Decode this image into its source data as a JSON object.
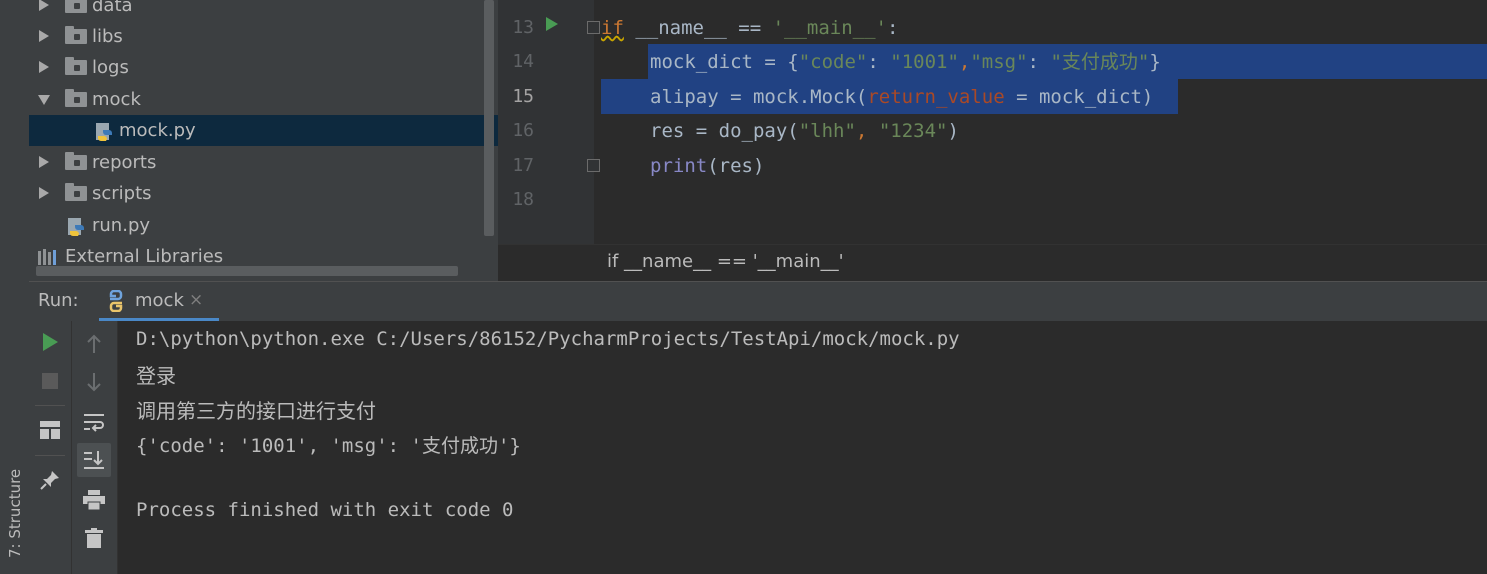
{
  "project_tree": {
    "items": [
      {
        "label": "data",
        "type": "folder",
        "expanded": false
      },
      {
        "label": "libs",
        "type": "folder",
        "expanded": false
      },
      {
        "label": "logs",
        "type": "folder",
        "expanded": false
      },
      {
        "label": "mock",
        "type": "folder",
        "expanded": true
      },
      {
        "label": "mock.py",
        "type": "python-file",
        "selected": true
      },
      {
        "label": "reports",
        "type": "folder",
        "expanded": false
      },
      {
        "label": "scripts",
        "type": "folder",
        "expanded": false
      },
      {
        "label": "run.py",
        "type": "python-file"
      },
      {
        "label": "External Libraries",
        "type": "libraries"
      }
    ]
  },
  "editor": {
    "line_numbers": [
      "13",
      "14",
      "15",
      "16",
      "17",
      "18"
    ],
    "lines": [
      {
        "if_kw": "if",
        "a": " __name__ == ",
        "s1": "'__main__'",
        "b": ":"
      },
      {
        "a": "mock_dict = {",
        "s1": "\"code\"",
        "b": ": ",
        "s2": "\"1001\"",
        "c": ",",
        "s3": "\"msg\"",
        "d": ": ",
        "s4": "\"支付成功\"",
        "e": "}"
      },
      {
        "a": "alipay",
        "b": " = mock.Mock(",
        "p": "return_value",
        "c": " = mock_dict)"
      },
      {
        "a": "res = do_pay(",
        "s1": "\"lhh\"",
        "b": ", ",
        "s2": "\"1234\"",
        "c": ")"
      },
      {
        "fn": "print",
        "a": "(res)"
      }
    ],
    "breadcrumb": "if __name__ == '__main__'"
  },
  "run_panel": {
    "title": "Run:",
    "tab_label": "mock",
    "tab_close": "×",
    "console": [
      "D:\\python\\python.exe C:/Users/86152/PycharmProjects/TestApi/mock/mock.py",
      "登录",
      "调用第三方的接口进行支付",
      "{'code': '1001', 'msg': '支付成功'}",
      "",
      "Process finished with exit code 0"
    ]
  },
  "left_stripe": {
    "structure_label": "7: Structure"
  },
  "colors": {
    "selection": "#214283",
    "keyword": "#cc7832",
    "string": "#6a8759",
    "run_green": "#499c54"
  }
}
